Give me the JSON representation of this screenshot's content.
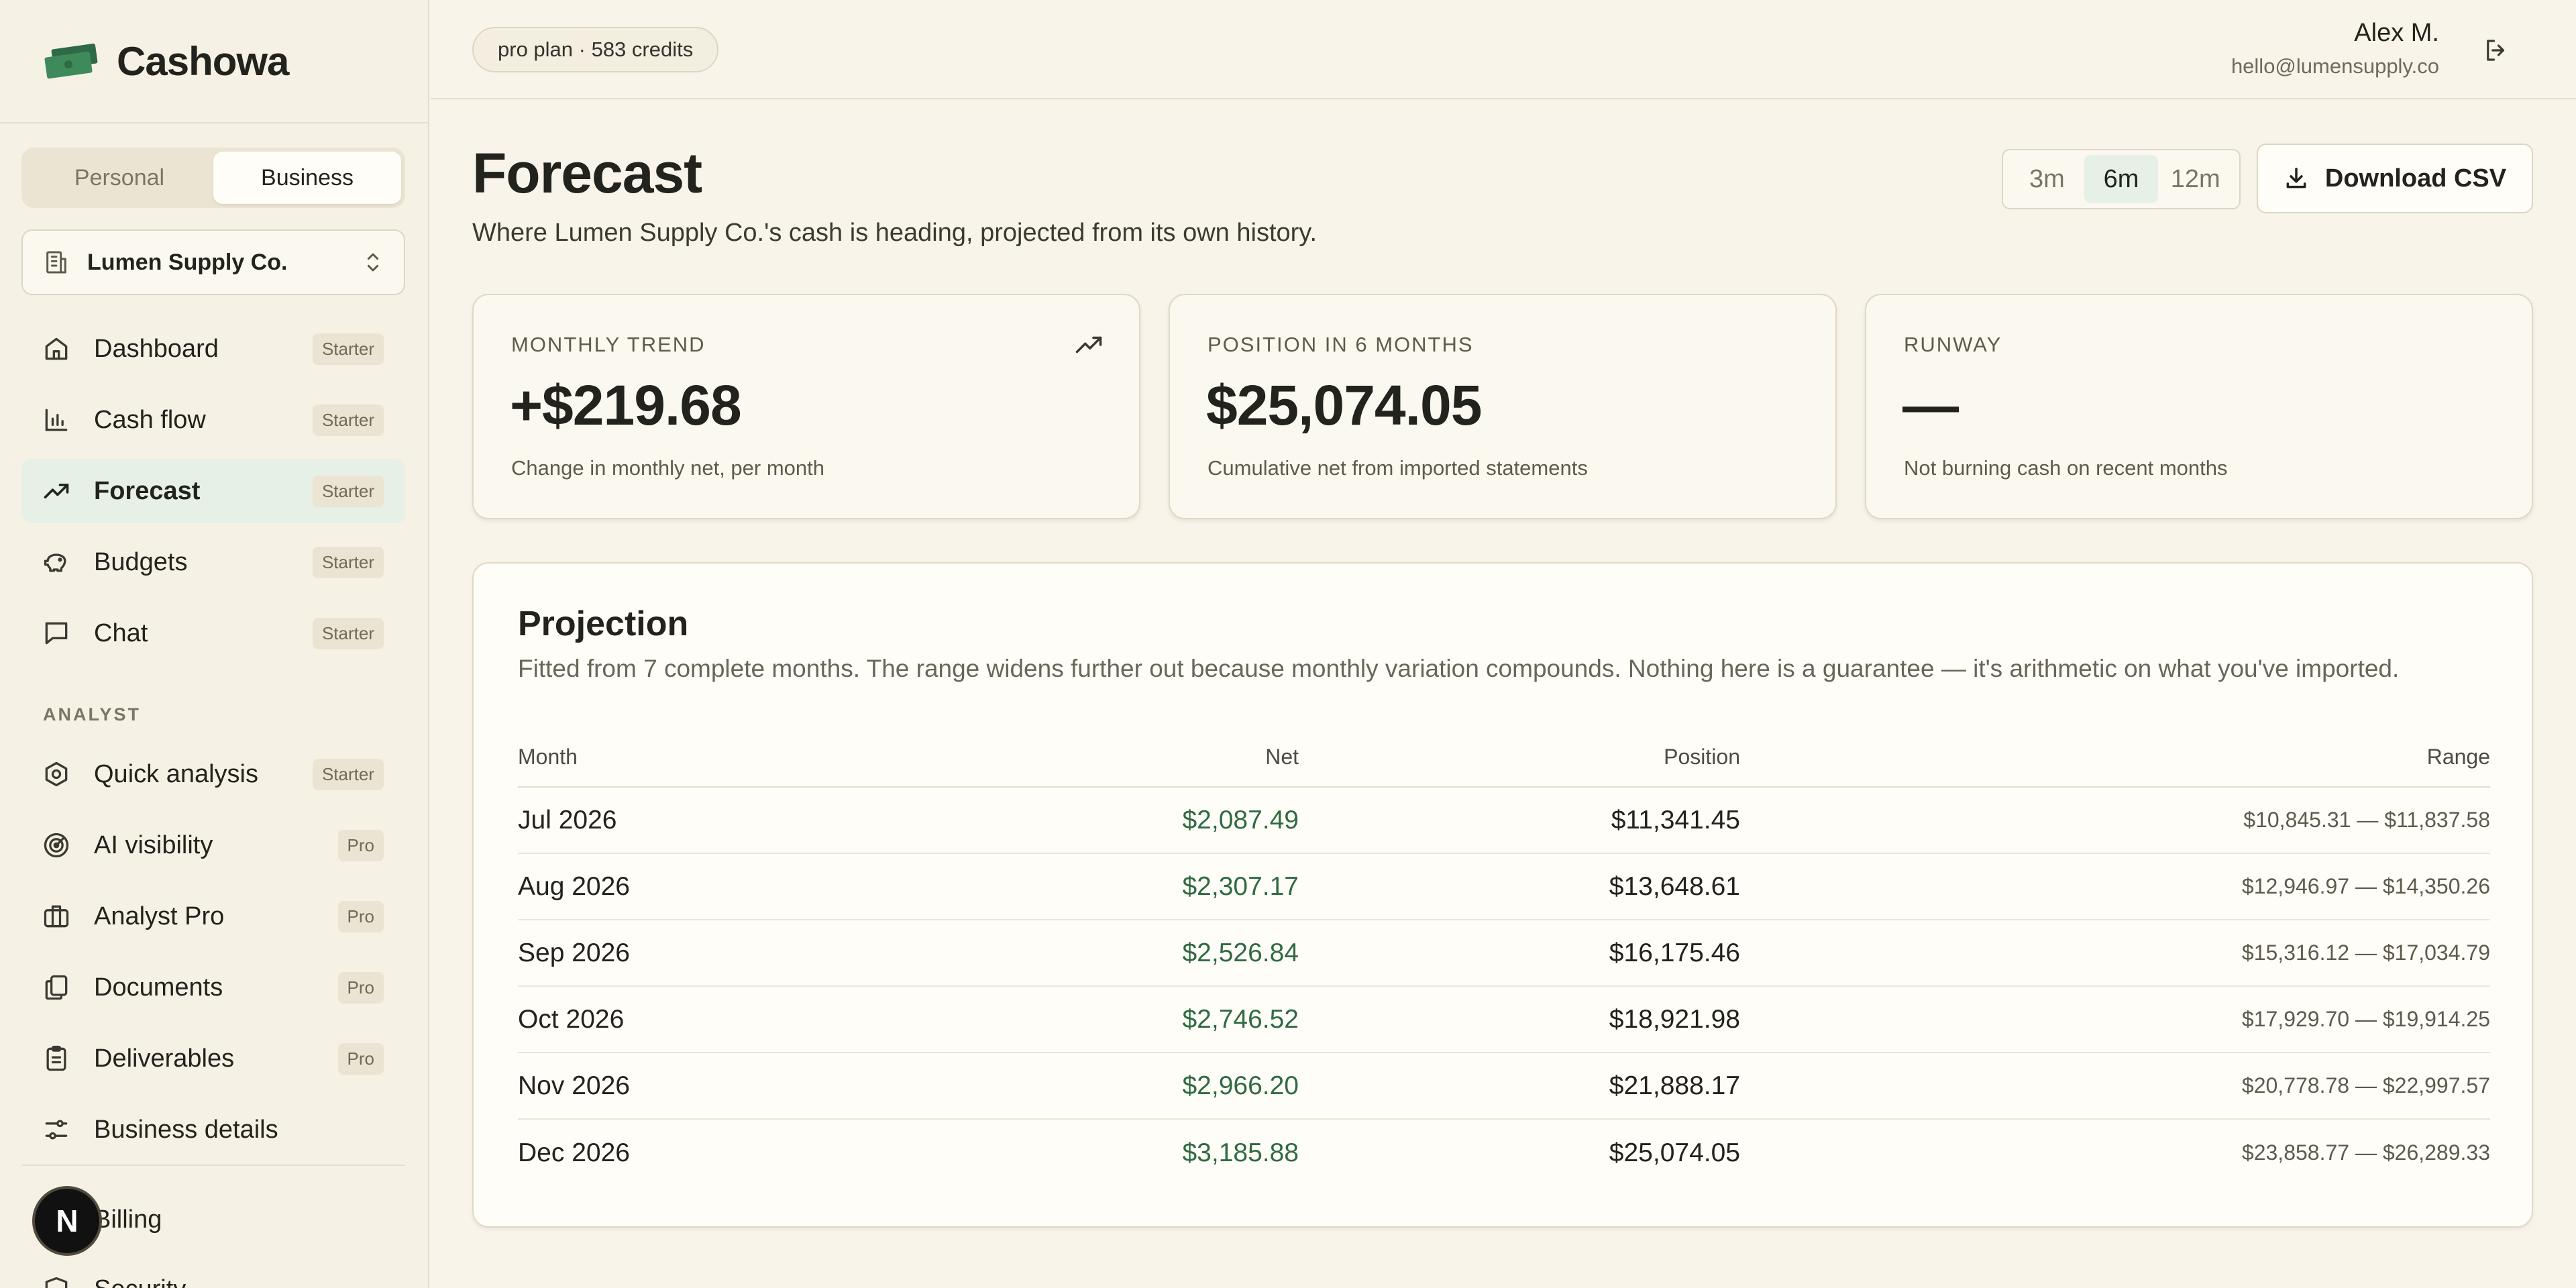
{
  "brand": {
    "name": "Cashowa"
  },
  "account_toggle": {
    "options": [
      "Personal",
      "Business"
    ],
    "selected": "Business"
  },
  "company": {
    "name": "Lumen Supply Co."
  },
  "nav": {
    "items": [
      {
        "label": "Dashboard",
        "badge": "Starter",
        "icon": "home-icon"
      },
      {
        "label": "Cash flow",
        "badge": "Starter",
        "icon": "bar-chart-icon"
      },
      {
        "label": "Forecast",
        "badge": "Starter",
        "icon": "trending-up-icon",
        "active": true
      },
      {
        "label": "Budgets",
        "badge": "Starter",
        "icon": "piggy-bank-icon"
      },
      {
        "label": "Chat",
        "badge": "Starter",
        "icon": "chat-icon"
      }
    ],
    "section_label": "ANALYST",
    "analyst_items": [
      {
        "label": "Quick analysis",
        "badge": "Starter",
        "icon": "hexagon-icon"
      },
      {
        "label": "AI visibility",
        "badge": "Pro",
        "icon": "radar-icon"
      },
      {
        "label": "Analyst Pro",
        "badge": "Pro",
        "icon": "briefcase-icon"
      },
      {
        "label": "Documents",
        "badge": "Pro",
        "icon": "documents-icon"
      },
      {
        "label": "Deliverables",
        "badge": "Pro",
        "icon": "clipboard-icon"
      },
      {
        "label": "Business details",
        "badge": "",
        "icon": "sliders-icon"
      }
    ],
    "footer_items": [
      {
        "label": "Billing",
        "icon": "billing-icon"
      },
      {
        "label": "Security",
        "icon": "shield-icon"
      }
    ],
    "avatar_letter": "N"
  },
  "header": {
    "plan": "pro plan · 583 credits",
    "user_name": "Alex M.",
    "user_email": "hello@lumensupply.co"
  },
  "page": {
    "title": "Forecast",
    "subtitle": "Where Lumen Supply Co.'s cash is heading, projected from its own history.",
    "ranges": [
      "3m",
      "6m",
      "12m"
    ],
    "selected_range": "6m",
    "download_label": "Download CSV"
  },
  "stats": [
    {
      "label": "MONTHLY TREND",
      "value": "+$219.68",
      "desc": "Change in monthly net, per month"
    },
    {
      "label": "POSITION IN 6 MONTHS",
      "value": "$25,074.05",
      "desc": "Cumulative net from imported statements"
    },
    {
      "label": "RUNWAY",
      "value": "—",
      "desc": "Not burning cash on recent months"
    }
  ],
  "projection": {
    "title": "Projection",
    "description": "Fitted from 7 complete months. The range widens further out because monthly variation compounds. Nothing here is a guarantee — it's arithmetic on what you've imported.",
    "columns": [
      "Month",
      "Net",
      "Position",
      "Range"
    ],
    "rows": [
      {
        "month": "Jul 2026",
        "net": "$2,087.49",
        "position": "$11,341.45",
        "range": "$10,845.31 — $11,837.58"
      },
      {
        "month": "Aug 2026",
        "net": "$2,307.17",
        "position": "$13,648.61",
        "range": "$12,946.97 — $14,350.26"
      },
      {
        "month": "Sep 2026",
        "net": "$2,526.84",
        "position": "$16,175.46",
        "range": "$15,316.12 — $17,034.79"
      },
      {
        "month": "Oct 2026",
        "net": "$2,746.52",
        "position": "$18,921.98",
        "range": "$17,929.70 — $19,914.25"
      },
      {
        "month": "Nov 2026",
        "net": "$2,966.20",
        "position": "$21,888.17",
        "range": "$20,778.78 — $22,997.57"
      },
      {
        "month": "Dec 2026",
        "net": "$3,185.88",
        "position": "$25,074.05",
        "range": "$23,858.77 — $26,289.33"
      }
    ]
  },
  "colors": {
    "background": "#f8f4ea",
    "accent_green": "#2f6b41",
    "active_nav": "#e6f0e6"
  }
}
